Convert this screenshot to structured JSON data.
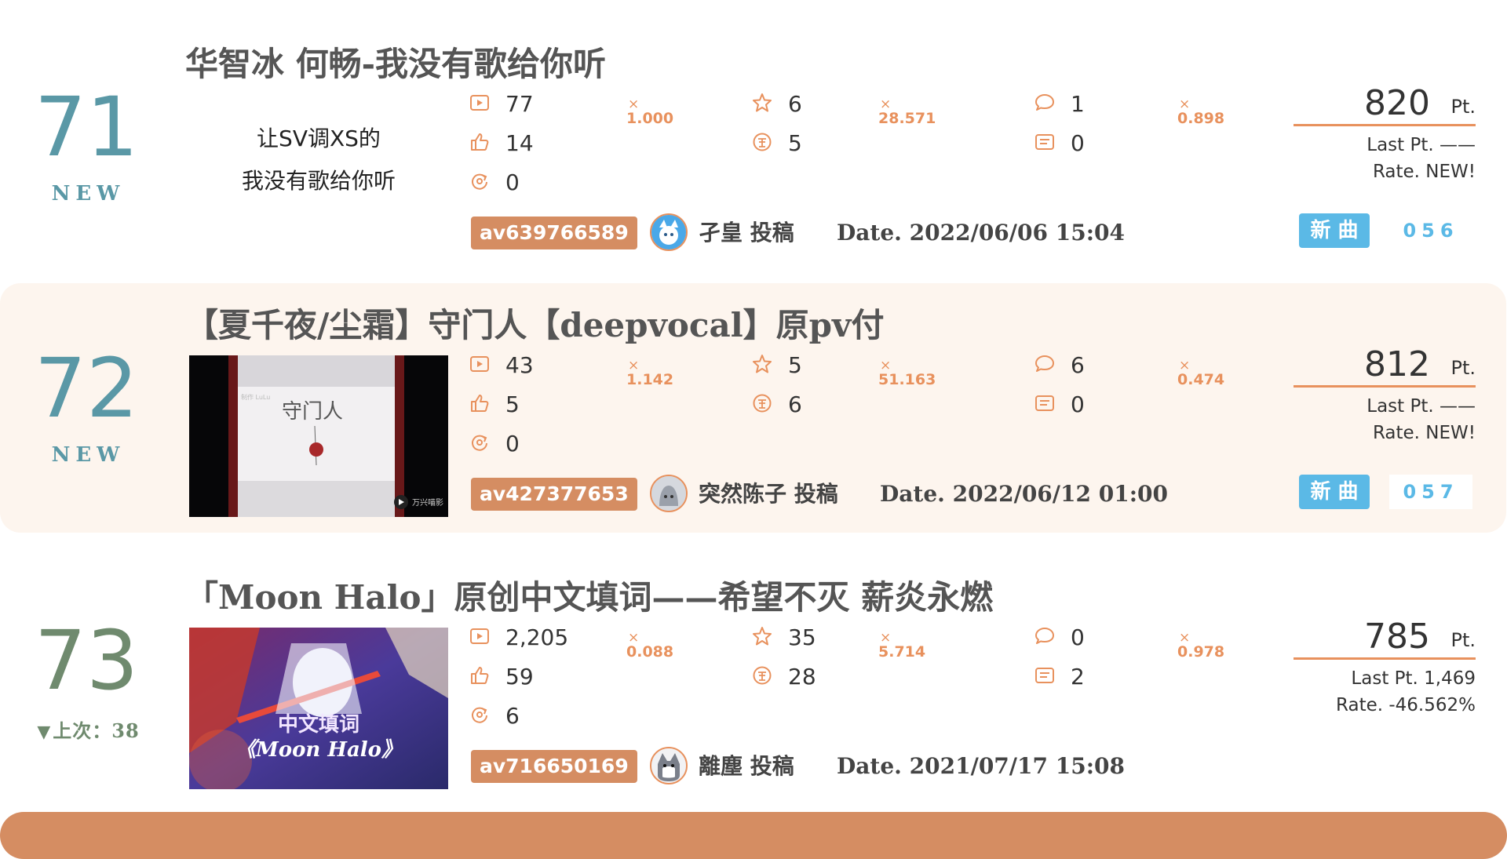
{
  "colors": {
    "accent": "#e8915d",
    "new_rank": "#5a98a6",
    "old_rank": "#6f8a6e",
    "badge": "#5bb9e6",
    "avid_bg": "#d58d62",
    "highlight": "#fdf5ee"
  },
  "entries": [
    {
      "rank": "71",
      "rank_sub": "NEW",
      "title": "华智冰 何畅-我没有歌给你听",
      "thumb_text": [
        "让SV调XS的",
        "我没有歌给你听"
      ],
      "views": "77",
      "views_mult": "1.000",
      "likes": "14",
      "shares": "0",
      "favorites": "6",
      "favorites_mult": "28.571",
      "coins": "5",
      "comments": "1",
      "comments_mult": "0.898",
      "danmaku": "0",
      "av": "av639766589",
      "uploader": "孑皇 投稿",
      "date": "Date. 2022/06/06 15:04",
      "points": "820",
      "pt_unit": "Pt.",
      "last_pt": "Last Pt. ——",
      "rate": "Rate. NEW!",
      "badge": "新 曲",
      "song_no": "056"
    },
    {
      "rank": "72",
      "rank_sub": "NEW",
      "title": "【夏千夜/尘霜】守门人【deepvocal】原pv付",
      "views": "43",
      "views_mult": "1.142",
      "likes": "5",
      "shares": "0",
      "favorites": "5",
      "favorites_mult": "51.163",
      "coins": "6",
      "comments": "6",
      "comments_mult": "0.474",
      "danmaku": "0",
      "av": "av427377653",
      "uploader": "突然陈子 投稿",
      "date": "Date. 2022/06/12 01:00",
      "points": "812",
      "pt_unit": "Pt.",
      "last_pt": "Last Pt. ——",
      "rate": "Rate. NEW!",
      "badge": "新 曲",
      "song_no": "057",
      "thumb_title": "守门人",
      "thumb_brand": "万兴喵影",
      "thumb_tag": "制作 LuLu"
    },
    {
      "rank": "73",
      "rank_sub": "上次：38",
      "title": "「Moon Halo」原创中文填词——希望不灭 薪炎永燃",
      "views": "2,205",
      "views_mult": "0.088",
      "likes": "59",
      "shares": "6",
      "favorites": "35",
      "favorites_mult": "5.714",
      "coins": "28",
      "comments": "0",
      "comments_mult": "0.978",
      "danmaku": "2",
      "av": "av716650169",
      "uploader": "離塵 投稿",
      "date": "Date. 2021/07/17 15:08",
      "points": "785",
      "pt_unit": "Pt.",
      "last_pt": "Last Pt. 1,469",
      "rate": "Rate. -46.562%",
      "thumb_line1": "中文填词",
      "thumb_line2": "《Moon Halo》"
    }
  ]
}
